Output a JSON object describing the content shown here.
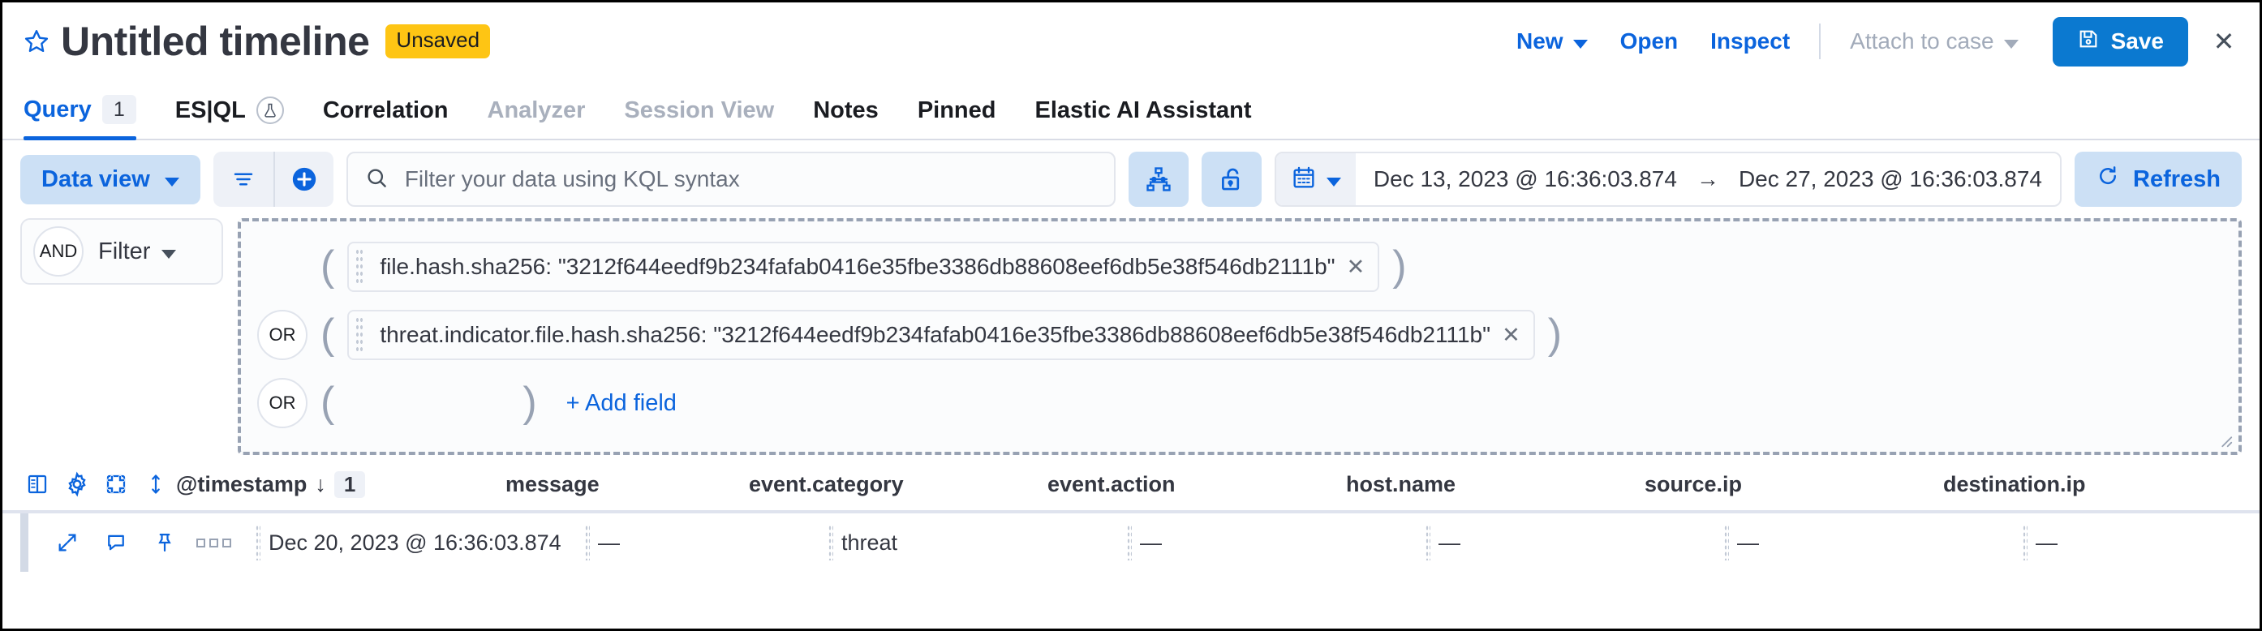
{
  "header": {
    "star_icon": "star-icon",
    "title": "Untitled timeline",
    "badge": "Unsaved",
    "new_label": "New",
    "open_label": "Open",
    "inspect_label": "Inspect",
    "attach_label": "Attach to case",
    "save_label": "Save",
    "close_label": "✕",
    "accent": "#0b64dd",
    "badge_color": "#fec514",
    "save_bg": "#0b79d0"
  },
  "tabs": [
    {
      "label": "Query",
      "badge": "1",
      "state": "active"
    },
    {
      "label": "ES|QL",
      "badge": "",
      "state": "normal",
      "icon": "beaker-icon"
    },
    {
      "label": "Correlation",
      "badge": "",
      "state": "normal"
    },
    {
      "label": "Analyzer",
      "badge": "",
      "state": "disabled"
    },
    {
      "label": "Session View",
      "badge": "",
      "state": "disabled"
    },
    {
      "label": "Notes",
      "badge": "",
      "state": "normal"
    },
    {
      "label": "Pinned",
      "badge": "",
      "state": "normal"
    },
    {
      "label": "Elastic AI Assistant",
      "badge": "",
      "state": "normal"
    }
  ],
  "querybar": {
    "data_view_label": "Data view",
    "filter_lines_icon": "filter-lines-icon",
    "add_icon": "add-circle-icon",
    "search_placeholder": "Filter your data using KQL syntax",
    "search_value": "",
    "search_icon": "search-icon",
    "relationships_icon": "relationships-icon",
    "unlock_icon": "unlock-icon",
    "calendar_icon": "calendar-icon",
    "date_start": "Dec 13, 2023 @ 16:36:03.874",
    "date_arrow": "→",
    "date_end": "Dec 27, 2023 @ 16:36:03.874",
    "refresh_label": "Refresh",
    "refresh_icon": "refresh-icon"
  },
  "filter_control": {
    "conjunction": "AND",
    "label": "Filter"
  },
  "builder": {
    "rows": [
      {
        "conjunction": "",
        "open_paren": "(",
        "close_paren": ")",
        "pill": "file.hash.sha256: \"3212f644eedf9b234fafab0416e35fbe3386db88608eef6db5e38f546db2111b\"",
        "remove": "✕",
        "empty": false
      },
      {
        "conjunction": "OR",
        "open_paren": "(",
        "close_paren": ")",
        "pill": "threat.indicator.file.hash.sha256: \"3212f644eedf9b234fafab0416e35fbe3386db88608eef6db5e38f546db2111b\"",
        "remove": "✕",
        "empty": false
      },
      {
        "conjunction": "OR",
        "open_paren": "(",
        "close_paren": ")",
        "pill": "",
        "remove": "",
        "empty": true,
        "add_field_label": "+ Add field"
      }
    ]
  },
  "grid": {
    "tools": [
      {
        "icon": "columns-icon"
      },
      {
        "icon": "gear-icon"
      },
      {
        "icon": "fullscreen-icon"
      },
      {
        "icon": "row-height-icon"
      }
    ],
    "columns": [
      {
        "label": "@timestamp",
        "sort": "↓",
        "sort_badge": "1"
      },
      {
        "label": "message"
      },
      {
        "label": "event.category"
      },
      {
        "label": "event.action"
      },
      {
        "label": "host.name"
      },
      {
        "label": "source.ip"
      },
      {
        "label": "destination.ip"
      }
    ],
    "row_actions": [
      {
        "icon": "expand-icon"
      },
      {
        "icon": "comment-icon"
      },
      {
        "icon": "pin-icon"
      },
      {
        "icon": "more-icon"
      }
    ],
    "rows": [
      {
        "timestamp": "Dec 20, 2023 @ 16:36:03.874",
        "message": "—",
        "event_category": "threat",
        "event_action": "—",
        "host_name": "—",
        "source_ip": "—",
        "destination_ip": "—"
      }
    ]
  }
}
